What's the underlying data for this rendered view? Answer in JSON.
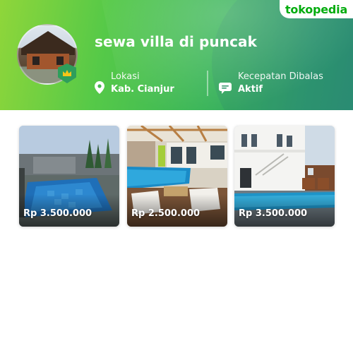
{
  "brand": {
    "name": "tokopedia",
    "color": "#03ac0e"
  },
  "shop": {
    "name": "sewa villa di puncak",
    "badge_icon": "crown-icon"
  },
  "info": {
    "location": {
      "label": "Lokasi",
      "value": "Kab. Cianjur",
      "icon": "map-pin-icon"
    },
    "response": {
      "label": "Kecepatan Dibalas",
      "value": "Aktif",
      "icon": "chat-bubble-icon"
    }
  },
  "products": [
    {
      "price": "Rp 3.500.000"
    },
    {
      "price": "Rp 2.500.000"
    },
    {
      "price": "Rp 3.500.000"
    }
  ]
}
